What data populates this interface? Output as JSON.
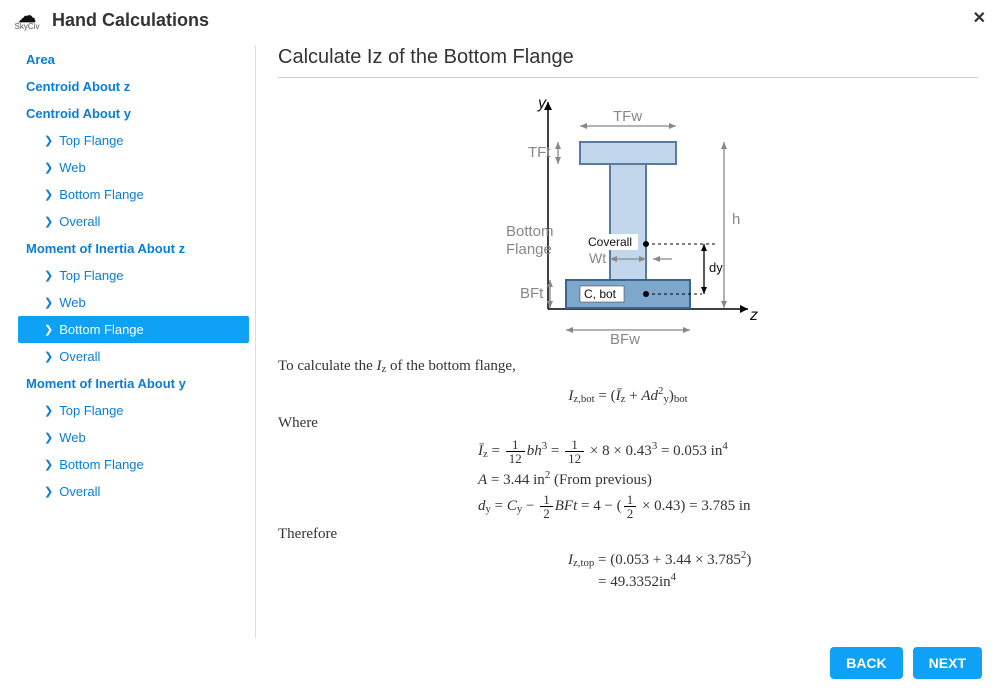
{
  "header": {
    "logo_text": "SkyCiv",
    "title": "Hand Calculations",
    "close": "✕"
  },
  "sidebar": {
    "items": [
      {
        "label": "Area",
        "sub": false,
        "active": false
      },
      {
        "label": "Centroid About z",
        "sub": false,
        "active": false
      },
      {
        "label": "Centroid About y",
        "sub": false,
        "active": false
      },
      {
        "label": "Top Flange",
        "sub": true,
        "active": false
      },
      {
        "label": "Web",
        "sub": true,
        "active": false
      },
      {
        "label": "Bottom Flange",
        "sub": true,
        "active": false
      },
      {
        "label": "Overall",
        "sub": true,
        "active": false
      },
      {
        "label": "Moment of Inertia About z",
        "sub": false,
        "active": false
      },
      {
        "label": "Top Flange",
        "sub": true,
        "active": false
      },
      {
        "label": "Web",
        "sub": true,
        "active": false
      },
      {
        "label": "Bottom Flange",
        "sub": true,
        "active": true
      },
      {
        "label": "Overall",
        "sub": true,
        "active": false
      },
      {
        "label": "Moment of Inertia About y",
        "sub": false,
        "active": false
      },
      {
        "label": "Top Flange",
        "sub": true,
        "active": false
      },
      {
        "label": "Web",
        "sub": true,
        "active": false
      },
      {
        "label": "Bottom Flange",
        "sub": true,
        "active": false
      },
      {
        "label": "Overall",
        "sub": true,
        "active": false
      }
    ]
  },
  "content": {
    "title": "Calculate Iz of the Bottom Flange",
    "para1_pre": "To calculate the ",
    "para1_sym": "I",
    "para1_sub": "z",
    "para1_post": " of the bottom flange,",
    "where": "Where",
    "therefore": "Therefore",
    "eq_main_lhs_sym": "I",
    "eq_main_lhs_sub": "z,bot",
    "eq_main_rhs_pre": " = (",
    "eq_main_rhs_ibar": "Ī",
    "eq_main_rhs_ibar_sub": "z",
    "eq_main_rhs_mid": " + ",
    "eq_main_rhs_A": "A",
    "eq_main_rhs_d": "d",
    "eq_main_rhs_d_sup": "2",
    "eq_main_rhs_d_sub": "y",
    "eq_main_rhs_post": ")",
    "eq_main_rhs_postsub": "bot",
    "eq1_lhs": "Ī",
    "eq1_lhs_sub": "z",
    "eq1_frac_num": "1",
    "eq1_frac_den": "12",
    "eq1_bh": "bh",
    "eq1_exp3": "3",
    "eq1_times8": " × 8 × 0.43",
    "eq1_val": " = 0.053 in",
    "eq1_exp4": "4",
    "eq2_lhs": "A",
    "eq2_rhs": " = 3.44 in",
    "eq2_sup": "2",
    "eq2_note": " (From previous)",
    "eq3_lhs": "d",
    "eq3_lhs_sub": "y",
    "eq3_Cy": "C",
    "eq3_Cy_sub": "y",
    "eq3_minus": " − ",
    "eq3_half_num": "1",
    "eq3_half_den": "2",
    "eq3_BFt": "BFt",
    "eq3_eq4": " = 4 − (",
    "eq3_times": " × 0.43) = 3.785 in",
    "eq4_lhs": "I",
    "eq4_lhs_sub": "z,top",
    "eq4_rhs1": " = (0.053 + 3.44 × 3.785",
    "eq4_sup2": "2",
    "eq4_rhs1b": ")",
    "eq4_rhs2_pre": "= 49.3352in",
    "eq4_rhs2_sup": "4"
  },
  "diagram": {
    "y": "y",
    "z": "z",
    "TFw": "TFw",
    "TFt": "TFt",
    "BFt": "BFt",
    "BFw": "BFw",
    "h": "h",
    "dy": "dy",
    "Wt": "Wt",
    "Coverall": "Coverall",
    "Cbot": "C, bot",
    "bottom": "Bottom",
    "flange": "Flange"
  },
  "footer": {
    "back": "BACK",
    "next": "NEXT"
  }
}
